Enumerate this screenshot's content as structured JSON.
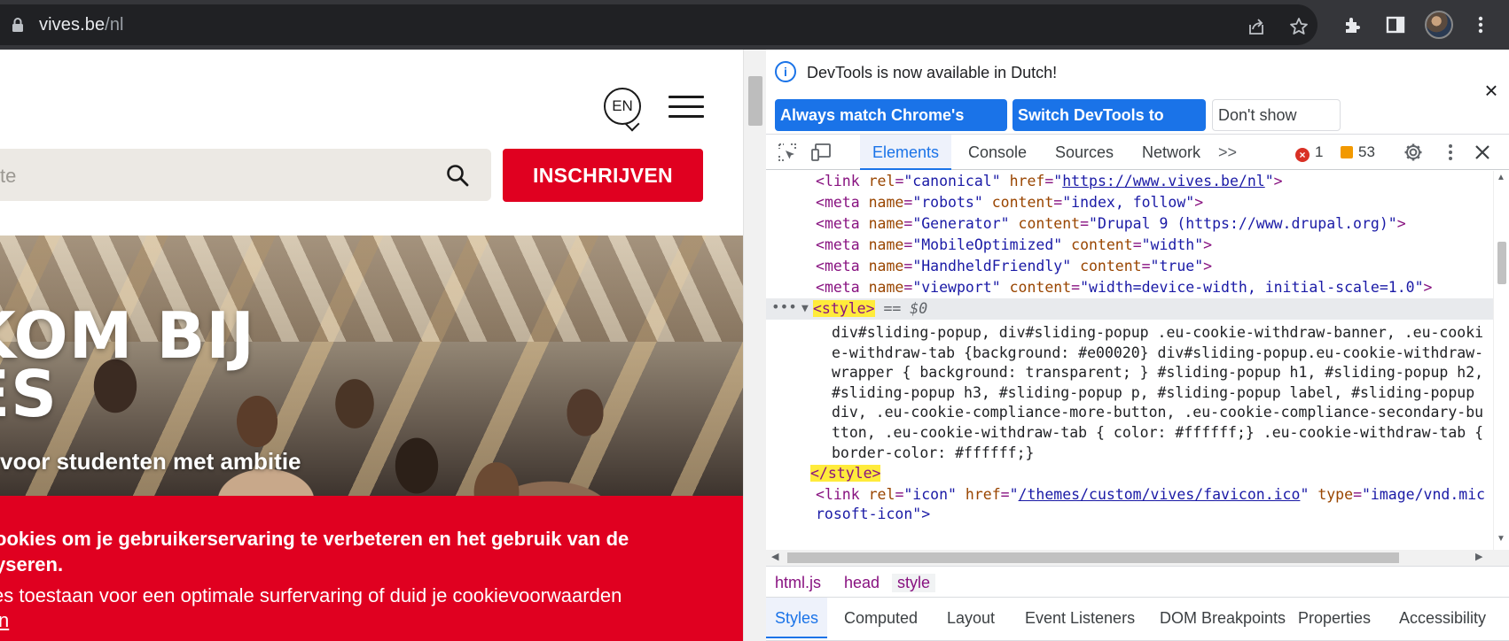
{
  "browser": {
    "url_host": "vives.be",
    "url_path": "/nl"
  },
  "page": {
    "lang_label": "EN",
    "search_placeholder": "te",
    "enroll_label": "INSCHRIJVEN",
    "hero_title_line1": "KOM BIJ",
    "hero_title_line2": "ES",
    "hero_subtitle": "voor studenten met ambitie",
    "cookie_title": "ookies om je gebruikerservaring te verbeteren en het gebruik van de yseren.",
    "cookie_text": "es toestaan voor een optimale surfervaring of duid je cookievoorwaarden",
    "cookie_link": "n"
  },
  "devtools": {
    "infobar": {
      "message": "DevTools is now available in Dutch!",
      "btn_match": "Always match Chrome's language",
      "btn_switch": "Switch DevTools to Dutch",
      "btn_dismiss": "Don't show again"
    },
    "tabs": [
      "Elements",
      "Console",
      "Sources",
      "Network"
    ],
    "more_tabs": ">>",
    "error_count": "1",
    "warning_count": "53",
    "code": {
      "l1": {
        "tag": "link",
        "a1": "rel",
        "v1": "\"canonical\"",
        "a2": "href",
        "v2": "https://www.vives.be/nl"
      },
      "l2": {
        "tag": "meta",
        "a1": "name",
        "v1": "\"robots\"",
        "a2": "content",
        "v2": "\"index, follow\""
      },
      "l3": {
        "tag": "meta",
        "a1": "name",
        "v1": "\"Generator\"",
        "a2": "content",
        "v2": "\"Drupal 9 (https://www.drupal.org)\""
      },
      "l4": {
        "tag": "meta",
        "a1": "name",
        "v1": "\"MobileOptimized\"",
        "a2": "content",
        "v2": "\"width\""
      },
      "l5": {
        "tag": "meta",
        "a1": "name",
        "v1": "\"HandheldFriendly\"",
        "a2": "content",
        "v2": "\"true\""
      },
      "l6": {
        "tag": "meta",
        "a1": "name",
        "v1": "\"viewport\"",
        "a2": "content",
        "v2": "\"width=device-width, initial-scale=1.0\""
      },
      "selected_open": "<style>",
      "selected_ref": "== $0",
      "css": "div#sliding-popup, div#sliding-popup .eu-cookie-withdraw-banner, .eu-cookie-withdraw-tab {background: #e00020} div#sliding-popup.eu-cookie-withdraw-wrapper { background: transparent; } #sliding-popup h1, #sliding-popup h2, #sliding-popup h3, #sliding-popup p, #sliding-popup label, #sliding-popup div, .eu-cookie-compliance-more-button, .eu-cookie-compliance-secondary-button, .eu-cookie-withdraw-tab { color: #ffffff;} .eu-cookie-withdraw-tab { border-color: #ffffff;}",
      "selected_close": "</style>",
      "l8": {
        "tag": "link",
        "a1": "rel",
        "v1": "\"icon\"",
        "a2": "href",
        "v2": "/themes/custom/vives/favicon.ico",
        "a3": "type",
        "v3": "\"image/vnd.mic",
        "wrap": "rosoft-icon\">"
      }
    },
    "breadcrumbs": [
      "html.js",
      "head",
      "style"
    ],
    "panel_tabs": [
      "Styles",
      "Computed",
      "Layout",
      "Event Listeners",
      "DOM Breakpoints",
      "Properties",
      "Accessibility"
    ]
  },
  "colors": {
    "brand_red": "#e00020",
    "accent_blue": "#1a73e8"
  }
}
